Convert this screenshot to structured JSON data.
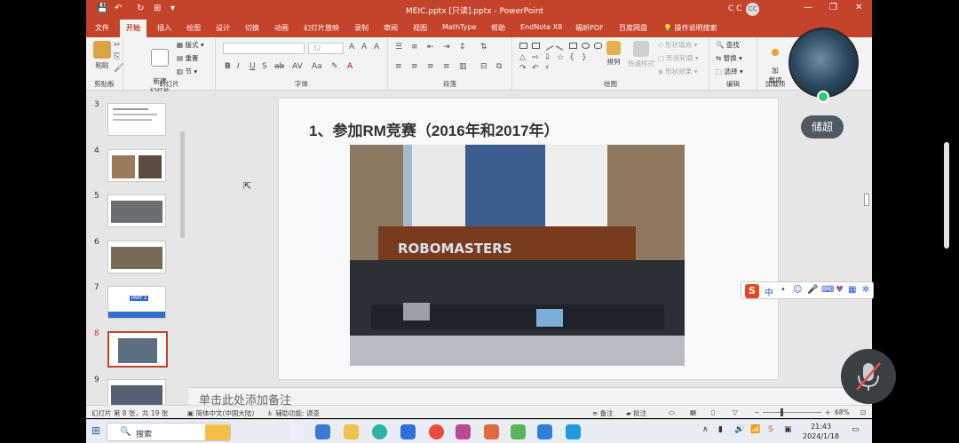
{
  "titlebar": {
    "document_title": "MEIC.pptx [只读].pptx - PowerPoint",
    "user_initials": "C C",
    "avatar": "CC"
  },
  "tabs": [
    "文件",
    "开始",
    "插入",
    "绘图",
    "设计",
    "切换",
    "动画",
    "幻灯片放映",
    "录制",
    "审阅",
    "视图",
    "MathType",
    "帮助",
    "EndNote X8",
    "福昕PDF",
    "百度网盘"
  ],
  "active_tab": "开始",
  "tell_me": "操作说明搜索",
  "ribbon": {
    "clipboard": {
      "paste": "粘贴",
      "label": "剪贴板"
    },
    "slides": {
      "new_slide": "新建\n幻灯片",
      "layout": "版式",
      "reset": "重置",
      "section": "节",
      "label": "幻灯片"
    },
    "font": {
      "label": "字体",
      "size": "32"
    },
    "paragraph": {
      "label": "段落"
    },
    "drawing": {
      "arrange": "排列",
      "quick_styles": "快速样式",
      "fill": "形状填充",
      "outline": "形状轮廓",
      "effects": "形状效果",
      "label": "绘图"
    },
    "editing": {
      "find": "查找",
      "replace": "替换",
      "select": "选择",
      "label": "编辑"
    },
    "addins": {
      "button": "加\n载项",
      "label": "加载项"
    }
  },
  "thumbnails": [
    {
      "num": "3"
    },
    {
      "num": "4"
    },
    {
      "num": "5"
    },
    {
      "num": "6"
    },
    {
      "num": "7",
      "tag": "PART 2"
    },
    {
      "num": "8",
      "selected": true
    },
    {
      "num": "9"
    }
  ],
  "slide": {
    "title": "1、参加RM竞赛（2016年和2017年）",
    "banner_text": "ROBOMASTERS"
  },
  "notes_placeholder": "单击此处添加备注",
  "status": {
    "slide_position": "幻灯片 第 8 张，共 19 张",
    "language": "简体中文(中国大陆)",
    "accessibility": "辅助功能: 调查",
    "notes": "备注",
    "comments": "批注",
    "zoom": "68%"
  },
  "taskbar": {
    "search": "搜索",
    "time": "21:43",
    "date": "2024/1/18"
  },
  "overlays": {
    "participant_name": "储超",
    "ime_char": "中"
  }
}
